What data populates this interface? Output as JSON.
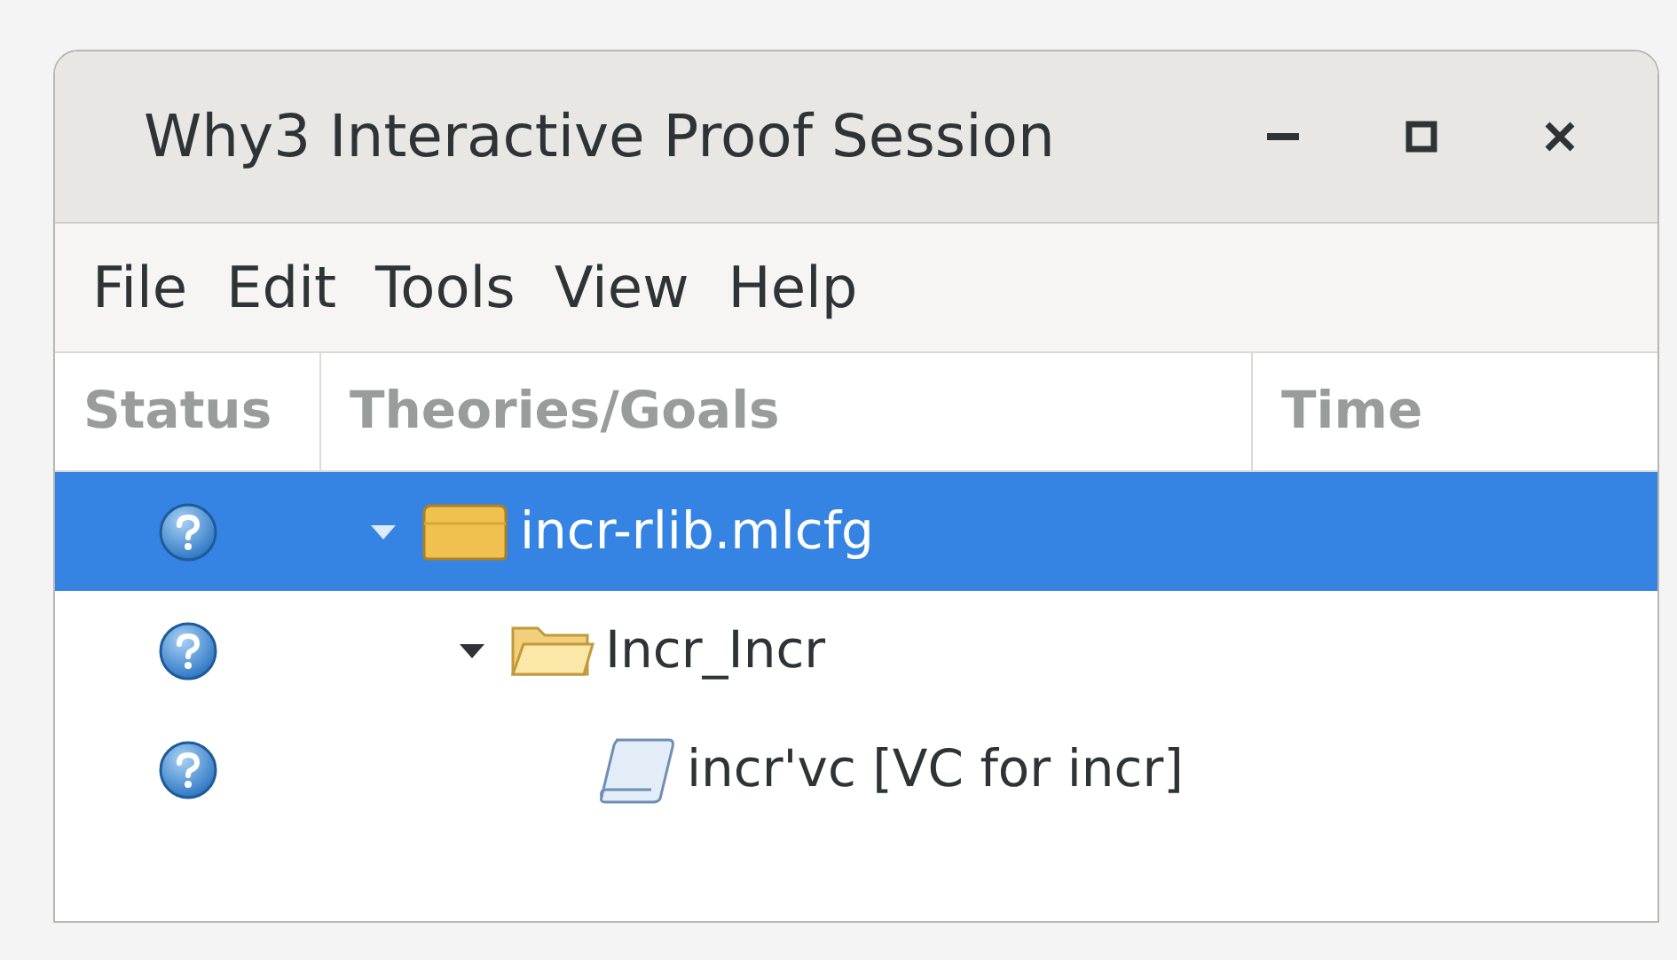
{
  "window": {
    "title": "Why3 Interactive Proof Session"
  },
  "menu": [
    "File",
    "Edit",
    "Tools",
    "View",
    "Help"
  ],
  "table": {
    "columns": [
      "Status",
      "Theories/Goals",
      "Time"
    ],
    "rows": [
      {
        "kind": "file",
        "proved": false,
        "label": "incr-rlib.mlcfg",
        "selected": true,
        "expanded": true,
        "children": [
          {
            "kind": "theory",
            "proved": false,
            "label": "Incr_Incr",
            "selected": false,
            "expanded": true,
            "children": [
              {
                "kind": "goal",
                "proved": false,
                "label": "incr'vc [VC for incr]",
                "selected": false
              }
            ]
          }
        ]
      }
    ]
  }
}
